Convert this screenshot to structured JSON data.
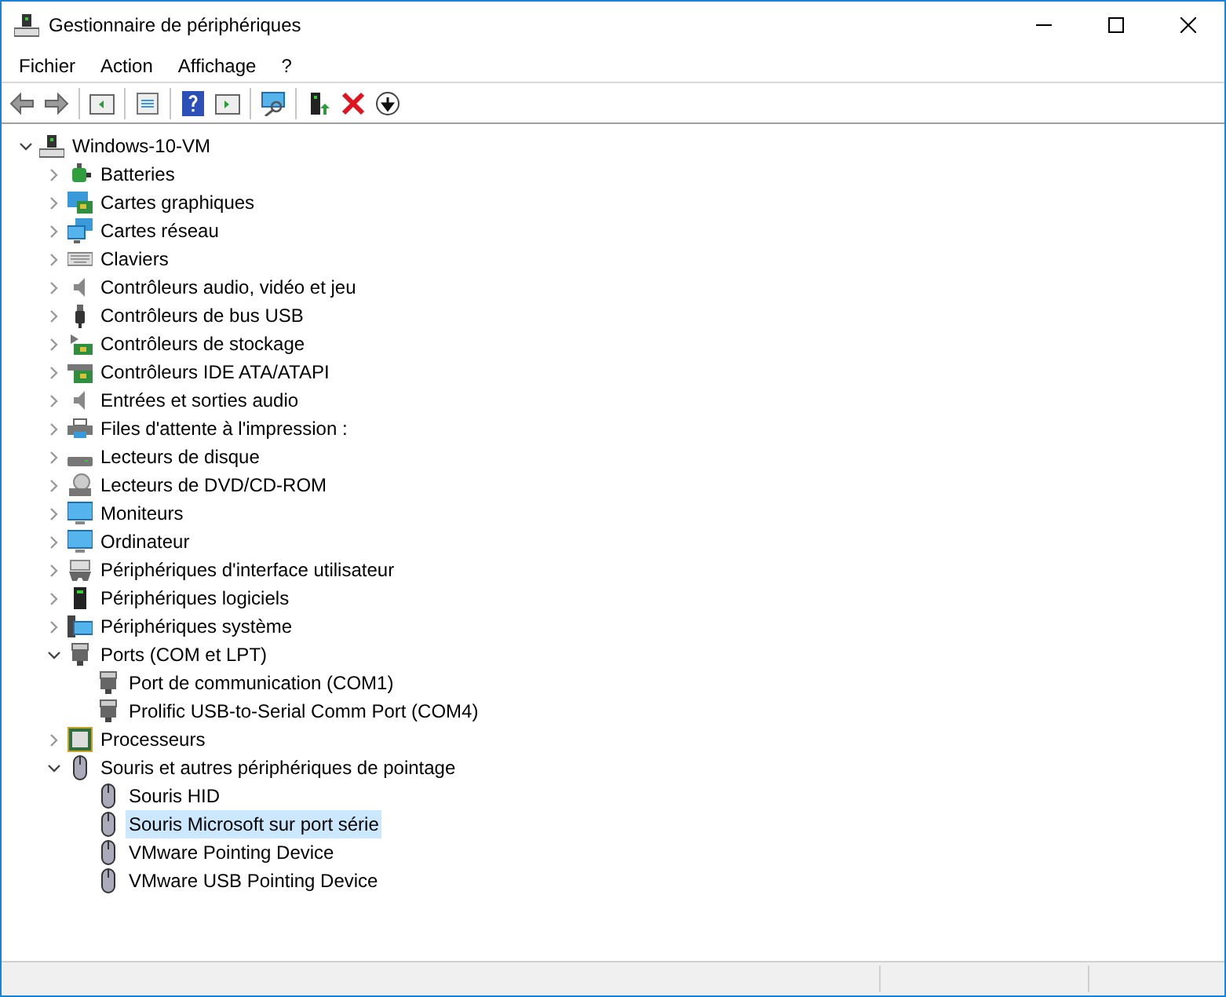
{
  "window": {
    "title": "Gestionnaire de périphériques"
  },
  "menu": [
    "Fichier",
    "Action",
    "Affichage",
    "?"
  ],
  "tree": {
    "label": "Windows-10-VM",
    "expanded": true,
    "selected": false,
    "children": [
      {
        "label": "Batteries",
        "expanded": false,
        "selected": false
      },
      {
        "label": "Cartes graphiques",
        "expanded": false,
        "selected": false
      },
      {
        "label": "Cartes réseau",
        "expanded": false,
        "selected": false
      },
      {
        "label": "Claviers",
        "expanded": false,
        "selected": false
      },
      {
        "label": "Contrôleurs audio, vidéo et jeu",
        "expanded": false,
        "selected": false
      },
      {
        "label": "Contrôleurs de bus USB",
        "expanded": false,
        "selected": false
      },
      {
        "label": "Contrôleurs de stockage",
        "expanded": false,
        "selected": false
      },
      {
        "label": "Contrôleurs IDE ATA/ATAPI",
        "expanded": false,
        "selected": false
      },
      {
        "label": "Entrées et sorties audio",
        "expanded": false,
        "selected": false
      },
      {
        "label": "Files d'attente à l'impression :",
        "expanded": false,
        "selected": false
      },
      {
        "label": "Lecteurs de disque",
        "expanded": false,
        "selected": false
      },
      {
        "label": "Lecteurs de DVD/CD-ROM",
        "expanded": false,
        "selected": false
      },
      {
        "label": "Moniteurs",
        "expanded": false,
        "selected": false
      },
      {
        "label": "Ordinateur",
        "expanded": false,
        "selected": false
      },
      {
        "label": "Périphériques d'interface utilisateur",
        "expanded": false,
        "selected": false
      },
      {
        "label": "Périphériques logiciels",
        "expanded": false,
        "selected": false
      },
      {
        "label": "Périphériques système",
        "expanded": false,
        "selected": false
      },
      {
        "label": "Ports (COM et LPT)",
        "expanded": true,
        "selected": false,
        "children": [
          {
            "label": "Port de communication (COM1)",
            "selected": false
          },
          {
            "label": "Prolific USB-to-Serial Comm Port (COM4)",
            "selected": false
          }
        ]
      },
      {
        "label": "Processeurs",
        "expanded": false,
        "selected": false
      },
      {
        "label": "Souris et autres périphériques de pointage",
        "expanded": true,
        "selected": false,
        "children": [
          {
            "label": "Souris HID",
            "selected": false
          },
          {
            "label": "Souris Microsoft sur port série",
            "selected": true
          },
          {
            "label": "VMware Pointing Device",
            "selected": false
          },
          {
            "label": "VMware USB Pointing Device",
            "selected": false
          }
        ]
      }
    ]
  }
}
